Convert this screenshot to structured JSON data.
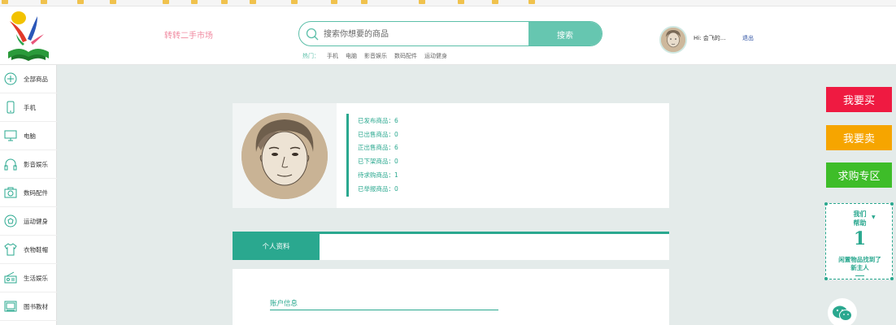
{
  "header": {
    "site_name": "转转二手市场",
    "search_placeholder": "搜索你想要的商品",
    "search_button": "搜索",
    "hot_label": "热门：",
    "hot_items": [
      "手机",
      "电脑",
      "影音娱乐",
      "数码配件",
      "运动健身"
    ],
    "user_greeting": "Hi: 会飞的...",
    "logout": "退出"
  },
  "sidebar": {
    "items": [
      {
        "label": "全部商品",
        "icon": "plus-circle-icon"
      },
      {
        "label": "手机",
        "icon": "phone-icon"
      },
      {
        "label": "电脑",
        "icon": "monitor-icon"
      },
      {
        "label": "影音娱乐",
        "icon": "headphones-icon"
      },
      {
        "label": "数码配件",
        "icon": "camera-icon"
      },
      {
        "label": "运动健身",
        "icon": "ball-icon"
      },
      {
        "label": "衣物鞋帽",
        "icon": "shirt-icon"
      },
      {
        "label": "生活娱乐",
        "icon": "radio-icon"
      },
      {
        "label": "图书教材",
        "icon": "book-icon"
      }
    ]
  },
  "profile": {
    "stats": [
      "已发布商品：6",
      "已出售商品：0",
      "正出售商品：6",
      "已下架商品：0",
      "待求购商品：1",
      "已举报商品：0"
    ]
  },
  "tabs": {
    "active": "个人资料"
  },
  "account": {
    "title": "账户信息"
  },
  "right_panel": {
    "buy": "我要买",
    "sell": "我要卖",
    "want": "求购专区",
    "help_line1": "我们",
    "help_line2": "帮助",
    "help_number": "1",
    "help_text_line1": "闲置物品找到了",
    "help_text_line2": "新主人"
  },
  "colors": {
    "accent": "#2aa88f",
    "buy": "#ef1a41",
    "sell": "#f6a500",
    "want": "#3ebd29"
  }
}
